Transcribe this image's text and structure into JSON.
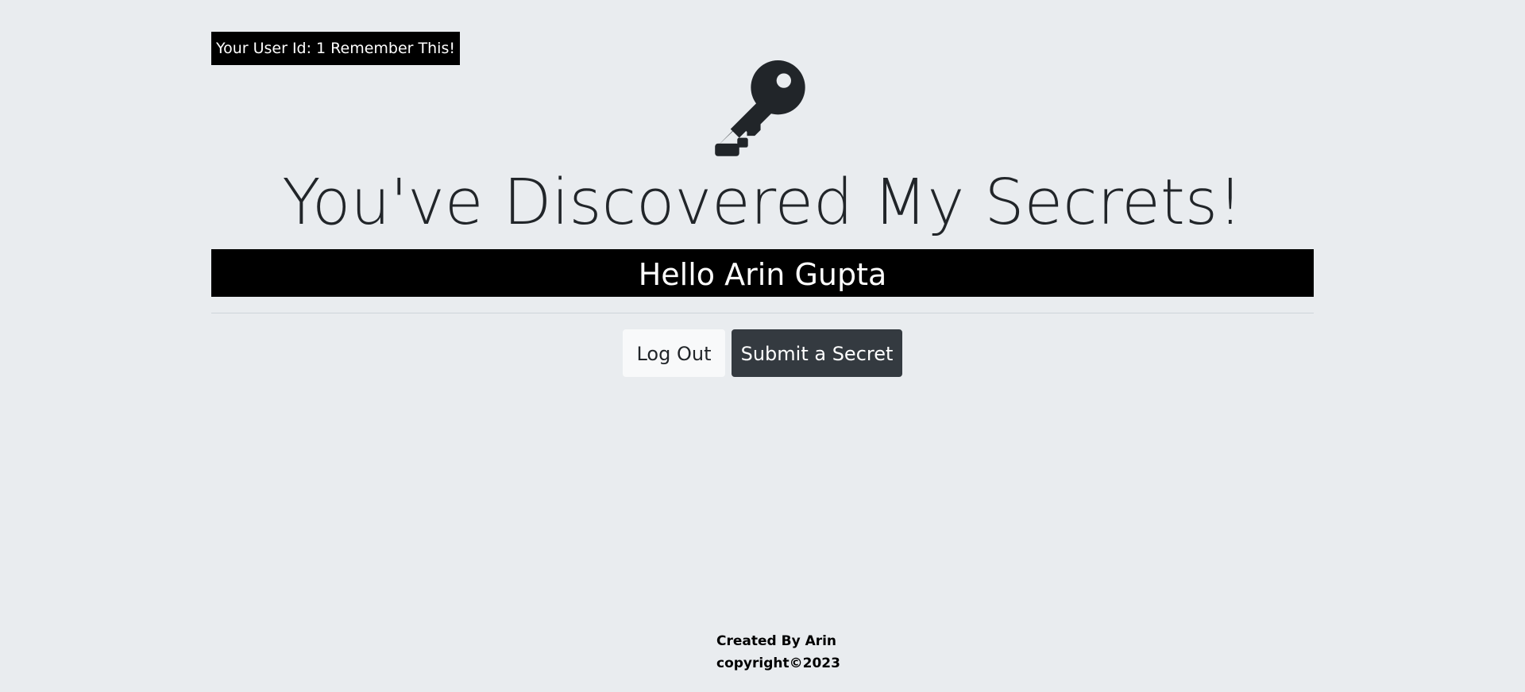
{
  "badge": {
    "user_id_text": "Your User Id: 1 Remember This!"
  },
  "header": {
    "icon": "key-icon",
    "title": "You've Discovered My Secrets!"
  },
  "greeting": {
    "text": "Hello Arin Gupta"
  },
  "actions": {
    "logout_label": "Log Out",
    "submit_label": "Submit a Secret"
  },
  "footer": {
    "created_by": "Created By Arin",
    "copyright": "copyright©2023"
  },
  "colors": {
    "background": "#e9ecef",
    "text": "#212529",
    "banner": "#000000",
    "button_light": "#f8f9fa",
    "button_dark": "#343a40"
  }
}
